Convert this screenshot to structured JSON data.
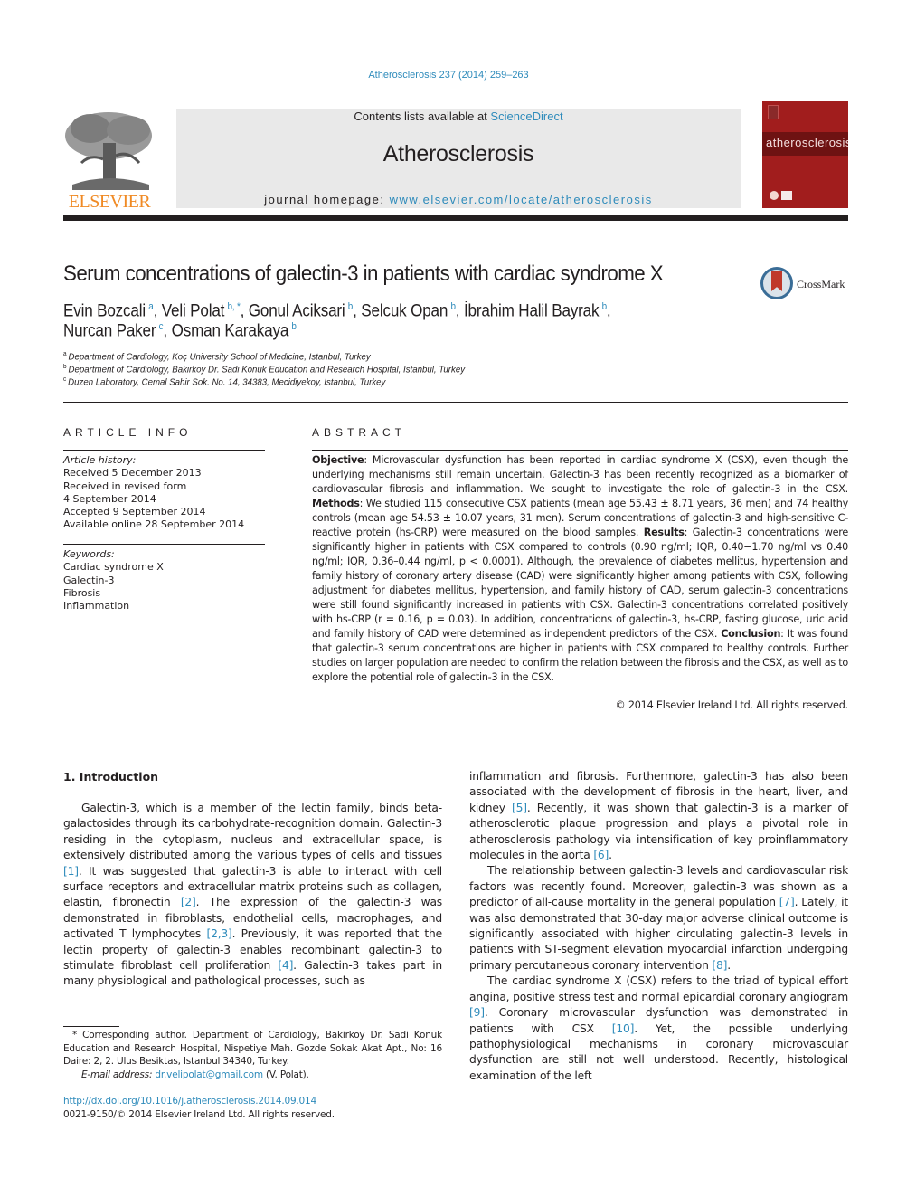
{
  "header": {
    "citation": "Atherosclerosis 237 (2014) 259–263",
    "contents_prefix": "Contents lists available at ",
    "contents_link": "ScienceDirect",
    "journal_title": "Atherosclerosis",
    "homepage_prefix": "journal homepage: ",
    "homepage_link": "www.elsevier.com/locate/atherosclerosis",
    "publisher_logo": "ELSEVIER",
    "cover_title": "atherosclerosis",
    "colors": {
      "link": "#2e8bbb",
      "elsevier_orange": "#f08a24",
      "cover_red": "#a11d1d",
      "band_gray": "#e9e9e9"
    }
  },
  "article": {
    "title": "Serum concentrations of galectin-3 in patients with cardiac syndrome X",
    "crossmark_label": "CrossMark",
    "authors": [
      {
        "name": "Evin Bozcali",
        "sup": "a",
        "sep": ", "
      },
      {
        "name": "Veli Polat",
        "sup": "b, *",
        "sep": ", "
      },
      {
        "name": "Gonul Aciksari",
        "sup": "b",
        "sep": ", "
      },
      {
        "name": "Selcuk Opan",
        "sup": "b",
        "sep": ", "
      },
      {
        "name": "İbrahim Halil Bayrak",
        "sup": "b",
        "sep": ","
      },
      {
        "name": "Nurcan Paker",
        "sup": "c",
        "sep": ", "
      },
      {
        "name": "Osman Karakaya",
        "sup": "b",
        "sep": ""
      }
    ],
    "affiliations": [
      {
        "key": "a",
        "text": "Department of Cardiology, Koç University School of Medicine, Istanbul, Turkey"
      },
      {
        "key": "b",
        "text": "Department of Cardiology, Bakirkoy Dr. Sadi Konuk Education and Research Hospital, Istanbul, Turkey"
      },
      {
        "key": "c",
        "text": "Duzen Laboratory, Cemal Sahir Sok. No. 14, 34383, Mecidiyekoy, Istanbul, Turkey"
      }
    ]
  },
  "article_info": {
    "heading": "ARTICLE INFO",
    "history_label": "Article history:",
    "history": [
      "Received 5 December 2013",
      "Received in revised form",
      "4 September 2014",
      "Accepted 9 September 2014",
      "Available online 28 September 2014"
    ],
    "keywords_label": "Keywords:",
    "keywords": [
      "Cardiac syndrome X",
      "Galectin-3",
      "Fibrosis",
      "Inflammation"
    ]
  },
  "abstract": {
    "heading": "ABSTRACT",
    "objective_label": "Objective",
    "objective": ": Microvascular dysfunction has been reported in cardiac syndrome X (CSX), even though the underlying mechanisms still remain uncertain. Galectin-3 has been recently recognized as a biomarker of cardiovascular fibrosis and inflammation. We sought to investigate the role of galectin-3 in the CSX. ",
    "methods_label": "Methods",
    "methods": ": We studied 115 consecutive CSX patients (mean age 55.43 ± 8.71 years, 36 men) and 74 healthy controls (mean age 54.53 ± 10.07 years, 31 men). Serum concentrations of galectin-3 and high-sensitive C-reactive protein (hs-CRP) were measured on the blood samples. ",
    "results_label": "Results",
    "results": ": Galectin-3 concentrations were significantly higher in patients with CSX compared to controls (0.90 ng/ml; IQR, 0.40−1.70 ng/ml vs 0.40 ng/ml; IQR, 0.36–0.44 ng/ml, p < 0.0001). Although, the prevalence of diabetes mellitus, hypertension and family history of coronary artery disease (CAD) were significantly higher among patients with CSX, following adjustment for diabetes mellitus, hypertension, and family history of CAD, serum galectin-3 concentrations were still found significantly increased in patients with CSX. Galectin-3 concentrations correlated positively with hs-CRP (r = 0.16, p = 0.03). In addition, concentrations of galectin-3, hs-CRP, fasting glucose, uric acid and family history of CAD were determined as independent predictors of the CSX. ",
    "conclusion_label": "Conclusion",
    "conclusion": ": It was found that galectin-3 serum concentrations are higher in patients with CSX compared to healthy controls. Further studies on larger population are needed to confirm the relation between the fibrosis and the CSX, as well as to explore the potential role of galectin-3 in the CSX.",
    "copyright": "© 2014 Elsevier Ireland Ltd. All rights reserved."
  },
  "introduction": {
    "heading": "1.  Introduction",
    "left_column": [
      {
        "t": "Galectin-3, which is a member of the lectin family, binds beta-galactosides through its carbohydrate-recognition domain. Galectin-3 residing in the cytoplasm, nucleus and extracellular space, is extensively distributed among the various types of cells and tissues ",
        "c": "[1]"
      },
      {
        "t": ". It was suggested that galectin-3 is able to interact with cell surface receptors and extracellular matrix proteins such as collagen, elastin, fibronectin ",
        "c": "[2]"
      },
      {
        "t": ". The expression of the galectin-3 was demonstrated in fibroblasts, endothelial cells, macrophages, and activated T lymphocytes ",
        "c": "[2,3]"
      },
      {
        "t": ". Previously, it was reported that the lectin property of galectin-3 enables recombinant galectin-3 to stimulate fibroblast cell proliferation ",
        "c": "[4]"
      },
      {
        "t": ". Galectin-3 takes part in many physiological and pathological processes, such as",
        "c": ""
      }
    ],
    "right_p1": [
      {
        "t": "inflammation and fibrosis. Furthermore, galectin-3 has also been associated with the development of fibrosis in the heart, liver, and kidney ",
        "c": "[5]"
      },
      {
        "t": ". Recently, it was shown that galectin-3 is a marker of atherosclerotic plaque progression and plays a pivotal role in atherosclerosis pathology via intensification of key proinflammatory molecules in the aorta ",
        "c": "[6]"
      },
      {
        "t": ".",
        "c": ""
      }
    ],
    "right_p2": [
      {
        "t": "The relationship between galectin-3 levels and cardiovascular risk factors was recently found. Moreover, galectin-3 was shown as a predictor of all-cause mortality in the general population ",
        "c": "[7]"
      },
      {
        "t": ". Lately, it was also demonstrated that 30-day major adverse clinical outcome is significantly associated with higher circulating galectin-3 levels in patients with ST-segment elevation myocardial infarction undergoing primary percutaneous coronary intervention ",
        "c": "[8]"
      },
      {
        "t": ".",
        "c": ""
      }
    ],
    "right_p3": [
      {
        "t": "The cardiac syndrome X (CSX) refers to the triad of typical effort angina, positive stress test and normal epicardial coronary angiogram ",
        "c": "[9]"
      },
      {
        "t": ". Coronary microvascular dysfunction was demonstrated in patients with CSX ",
        "c": "[10]"
      },
      {
        "t": ". Yet, the possible underlying pathophysiological mechanisms in coronary microvascular dysfunction are still not well understood. Recently, histological examination of the left",
        "c": ""
      }
    ]
  },
  "footnote": {
    "corresponding": "* Corresponding author. Department of Cardiology, Bakirkoy Dr. Sadi Konuk Education and Research Hospital, Nispetiye Mah. Gozde Sokak Akat Apt., No: 16 Daire: 2, 2. Ulus Besiktas, Istanbul 34340, Turkey.",
    "email_label": "E-mail address: ",
    "email": "dr.velipolat@gmail.com",
    "email_suffix": " (V. Polat).",
    "doi": "http://dx.doi.org/10.1016/j.atherosclerosis.2014.09.014",
    "issn": "0021-9150/© 2014 Elsevier Ireland Ltd. All rights reserved."
  }
}
